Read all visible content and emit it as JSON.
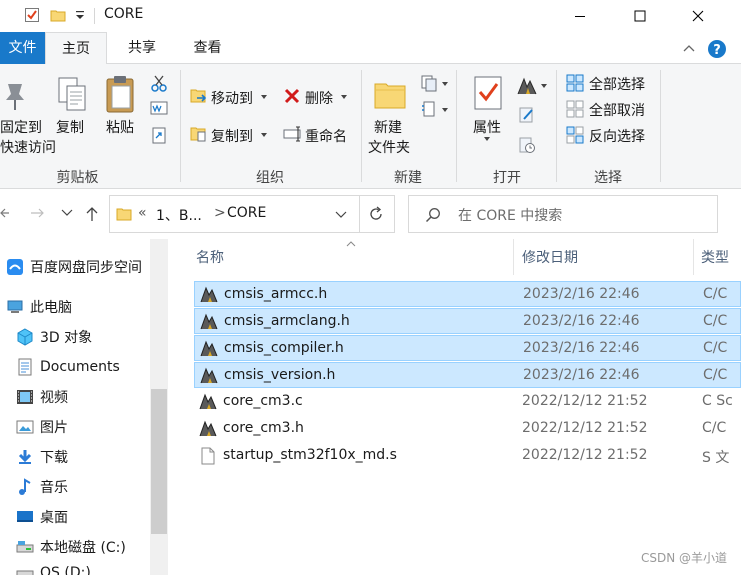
{
  "window": {
    "title": "CORE"
  },
  "tabs": {
    "file": "文件",
    "home": "主页",
    "share": "共享",
    "view": "查看"
  },
  "ribbon": {
    "clipboard": {
      "pin_line1": "固定到",
      "pin_line2": "快速访问",
      "copy": "复制",
      "paste": "粘贴",
      "label": "剪贴板"
    },
    "organize": {
      "move_to": "移动到",
      "copy_to": "复制到",
      "delete": "删除",
      "rename": "重命名",
      "label": "组织"
    },
    "new": {
      "new_folder_line1": "新建",
      "new_folder_line2": "文件夹",
      "label": "新建"
    },
    "open": {
      "properties": "属性",
      "label": "打开"
    },
    "select": {
      "select_all": "全部选择",
      "select_none": "全部取消",
      "invert": "反向选择",
      "label": "选择"
    }
  },
  "address": {
    "chevron": "«",
    "crumb1": "1、B...",
    "sep": ">",
    "crumb2": "CORE",
    "search_placeholder": "在 CORE 中搜索"
  },
  "nav": [
    {
      "label": "百度网盘同步空间",
      "icon": "baidu-netdisk-icon"
    },
    {
      "label": "此电脑",
      "icon": "this-pc-icon"
    },
    {
      "label": "3D 对象",
      "icon": "3d-objects-icon"
    },
    {
      "label": "Documents",
      "icon": "documents-icon"
    },
    {
      "label": "视频",
      "icon": "videos-icon"
    },
    {
      "label": "图片",
      "icon": "pictures-icon"
    },
    {
      "label": "下载",
      "icon": "downloads-icon"
    },
    {
      "label": "音乐",
      "icon": "music-icon"
    },
    {
      "label": "桌面",
      "icon": "desktop-icon"
    },
    {
      "label": "本地磁盘 (C:)",
      "icon": "drive-c-icon"
    },
    {
      "label": "OS (D:)",
      "icon": "drive-d-icon"
    }
  ],
  "columns": {
    "name": "名称",
    "date": "修改日期",
    "type": "类型"
  },
  "files": [
    {
      "name": "cmsis_armcc.h",
      "date": "2023/2/16 22:46",
      "type": "C/C",
      "selected": true,
      "icon": "keil-file-icon"
    },
    {
      "name": "cmsis_armclang.h",
      "date": "2023/2/16 22:46",
      "type": "C/C",
      "selected": true,
      "icon": "keil-file-icon"
    },
    {
      "name": "cmsis_compiler.h",
      "date": "2023/2/16 22:46",
      "type": "C/C",
      "selected": true,
      "icon": "keil-file-icon"
    },
    {
      "name": "cmsis_version.h",
      "date": "2023/2/16 22:46",
      "type": "C/C",
      "selected": true,
      "icon": "keil-file-icon"
    },
    {
      "name": "core_cm3.c",
      "date": "2022/12/12 21:52",
      "type": "C Sc",
      "selected": false,
      "icon": "keil-file-icon"
    },
    {
      "name": "core_cm3.h",
      "date": "2022/12/12 21:52",
      "type": "C/C",
      "selected": false,
      "icon": "keil-file-icon"
    },
    {
      "name": "startup_stm32f10x_md.s",
      "date": "2022/12/12 21:52",
      "type": "S 文",
      "selected": false,
      "icon": "blank-file-icon"
    }
  ],
  "watermark": "CSDN @羊小道",
  "colors": {
    "accent": "#1979ca",
    "selection": "#cce8ff",
    "selection_border": "#99d1ff"
  }
}
